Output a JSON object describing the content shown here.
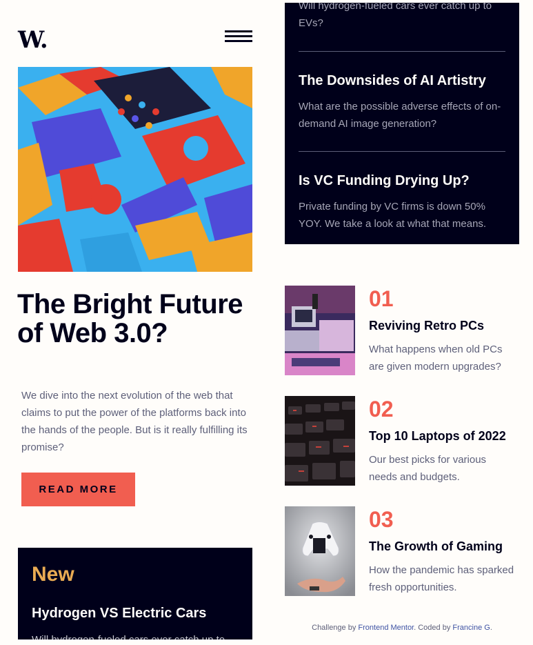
{
  "header": {
    "logo": "W.",
    "menu_icon": "hamburger-menu-icon"
  },
  "hero": {
    "image_alt": "3D colorful blocks",
    "title": "The Bright Future of Web 3.0?",
    "description": "We dive into the next evolution of the web that claims to put the power of the platforms back into the hands of the people. But is it really fulfilling its promise?",
    "button_label": "READ MORE"
  },
  "new_section": {
    "heading": "New",
    "items": [
      {
        "title": "Hydrogen VS Electric Cars",
        "description": "Will hydrogen-fueled cars ever catch up to EVs?"
      },
      {
        "title": "The Downsides of AI Artistry",
        "description": "What are the possible adverse effects of on-demand AI image generation?"
      },
      {
        "title": "Is VC Funding Drying Up?",
        "description": "Private funding by VC firms is down 50% YOY. We take a look at what that means."
      }
    ]
  },
  "ranked": [
    {
      "number": "01",
      "title": "Reviving Retro PCs",
      "description": "What happens when old PCs are given modern upgrades?"
    },
    {
      "number": "02",
      "title": "Top 10 Laptops of 2022",
      "description": "Our best picks for various needs and budgets."
    },
    {
      "number": "03",
      "title": "The Growth of Gaming",
      "description": "How the pandemic has sparked fresh opportunities."
    }
  ],
  "footer": {
    "prefix": "Challenge by",
    "link1": "Frontend Mentor",
    "middle": ". Coded by",
    "link2": "Francine G",
    "suffix": "."
  },
  "colors": {
    "background": "#fffdfa",
    "dark": "#00001a",
    "accent_red": "#f15e50",
    "accent_orange": "#e9ab53",
    "grey": "#5d5f79"
  }
}
